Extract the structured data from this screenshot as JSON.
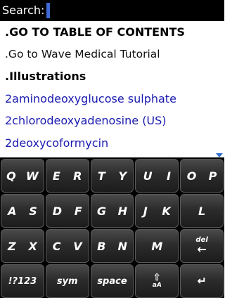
{
  "search": {
    "label": "Search:"
  },
  "results": [
    {
      "text": ".GO TO TABLE OF CONTENTS",
      "style": "bold"
    },
    {
      "text": ".Go to Wave Medical Tutorial",
      "style": "plain"
    },
    {
      "text": ".Illustrations",
      "style": "bold"
    },
    {
      "text": "2aminodeoxyglucose sulphate",
      "style": "link"
    },
    {
      "text": "2chlorodeoxyadenosine (US)",
      "style": "link"
    },
    {
      "text": "2deoxycoformycin",
      "style": "link"
    }
  ],
  "keyboard": {
    "row1": [
      [
        "Q",
        "W"
      ],
      [
        "E",
        "R"
      ],
      [
        "T",
        "Y"
      ],
      [
        "U",
        "I"
      ],
      [
        "O",
        "P"
      ]
    ],
    "row2": [
      [
        "A",
        "S"
      ],
      [
        "D",
        "F"
      ],
      [
        "G",
        "H"
      ],
      [
        "J",
        "K"
      ],
      [
        "L"
      ]
    ],
    "row3": [
      [
        "Z",
        "X"
      ],
      [
        "C",
        "V"
      ],
      [
        "B",
        "N"
      ],
      [
        "M"
      ]
    ],
    "del_label": "del",
    "sym_key": "!?123",
    "sym_label": "sym",
    "space_label": "space",
    "shift_small": "aA"
  },
  "colors": {
    "link": "#1a1ab0",
    "cursor": "#3d6ad6",
    "header_bg": "#000000"
  },
  "icons": {
    "delete": "backspace-arrow-icon",
    "shift": "shift-up-arrow-icon",
    "enter": "enter-return-icon"
  }
}
